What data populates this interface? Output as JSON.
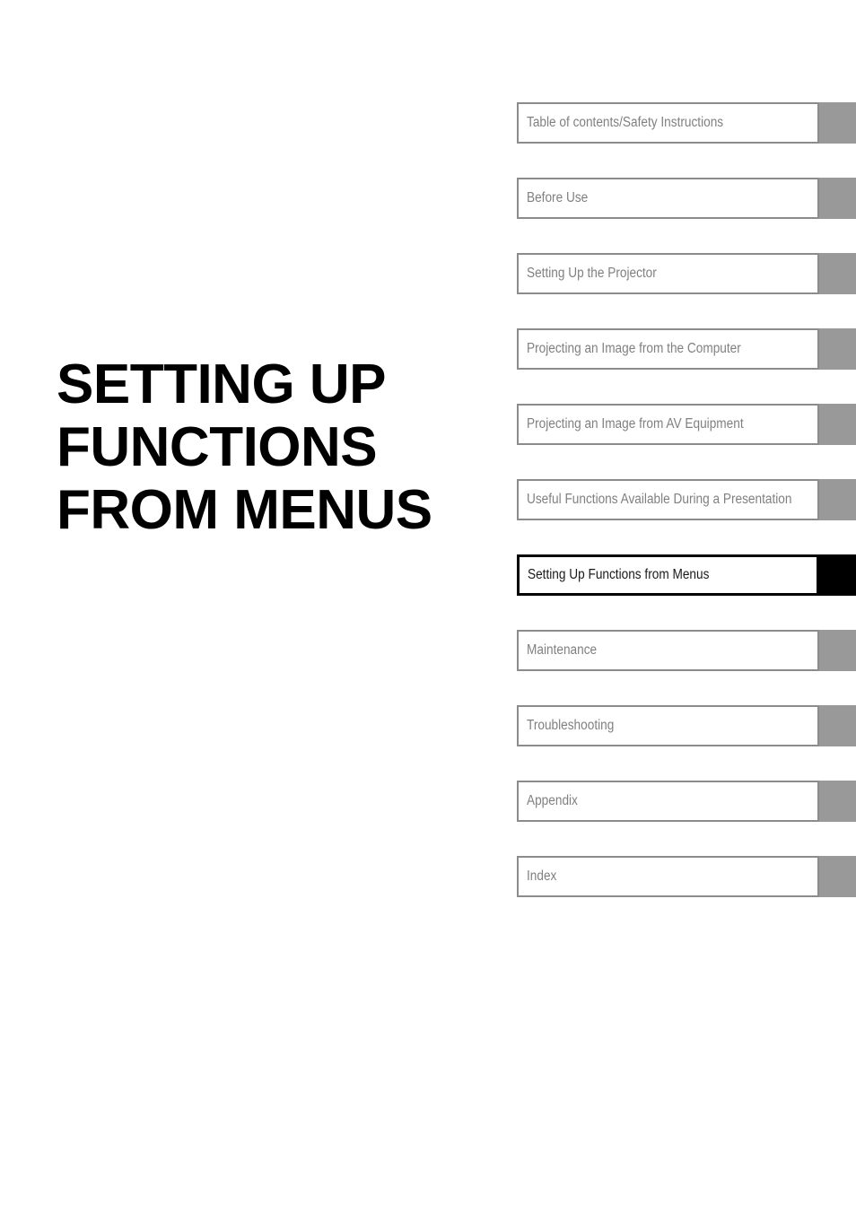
{
  "page": {
    "title_lines": "SETTING UP\nFUNCTIONS\nFROM MENUS",
    "background_color": "#ffffff"
  },
  "colors": {
    "tab_inactive": "#999999",
    "tab_active": "#000000",
    "border_inactive": "#8c8c8c",
    "border_active": "#000000",
    "label_inactive": "#808080",
    "label_active": "#1a1a1a",
    "title": "#000000"
  },
  "chapter_index": {
    "items": [
      {
        "label": "Table of contents/Safety Instructions",
        "active": false
      },
      {
        "label": "Before Use",
        "active": false
      },
      {
        "label": "Setting Up the Projector",
        "active": false
      },
      {
        "label": "Projecting an Image from the Computer",
        "active": false
      },
      {
        "label": "Projecting an Image from AV Equipment",
        "active": false
      },
      {
        "label": "Useful Functions Available During a Presentation",
        "active": false
      },
      {
        "label": "Setting Up Functions from Menus",
        "active": true
      },
      {
        "label": "Maintenance",
        "active": false
      },
      {
        "label": "Troubleshooting",
        "active": false
      },
      {
        "label": "Appendix",
        "active": false
      },
      {
        "label": "Index",
        "active": false
      }
    ]
  }
}
